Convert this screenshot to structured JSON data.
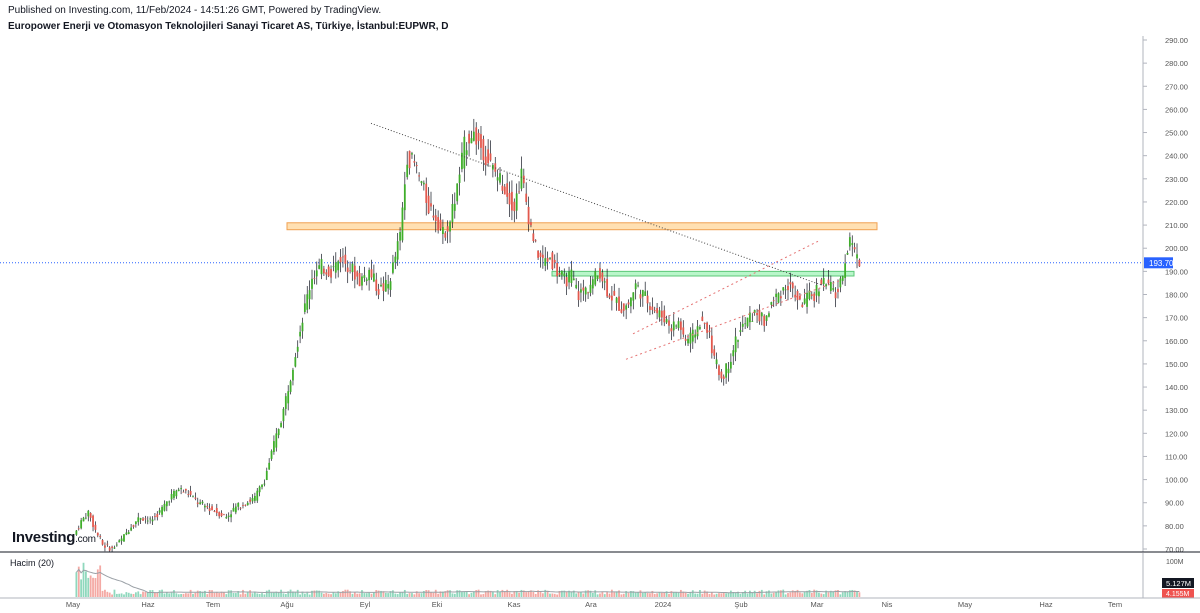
{
  "header": {
    "published": "Published on Investing.com, 11/Feb/2024 - 14:51:26 GMT, Powered by TradingView.",
    "symbol": "Europower Enerji ve Otomasyon Teknolojileri Sanayi Ticaret AS, Türkiye, İstanbul:EUPWR, D"
  },
  "logo": {
    "text": "Investing",
    "suffix": ".com"
  },
  "volume_panel": {
    "label": "Hacim (20)",
    "axis_max_label": "100M",
    "last_label": "5.127M",
    "ma_label": "4.155M"
  },
  "colors": {
    "up": "#26a69a",
    "down": "#ef5350",
    "up_candle": "#3fae2a",
    "down_candle": "#e2584d",
    "price_line": "#2962ff",
    "zone_resistance": "#ffe0b2",
    "zone_support": "#b9f6ca"
  },
  "chart_data": {
    "type": "candlestick",
    "title": "EUPWR, D",
    "y_axis": {
      "range": [
        70,
        290
      ],
      "ticks": [
        "70.00",
        "80.00",
        "90.00",
        "100.00",
        "110.00",
        "120.00",
        "130.00",
        "140.00",
        "150.00",
        "160.00",
        "170.00",
        "180.00",
        "190.00",
        "200.00",
        "210.00",
        "220.00",
        "230.00",
        "240.00",
        "250.00",
        "260.00",
        "270.00",
        "280.00",
        "290.00"
      ],
      "position": "right"
    },
    "x_axis": {
      "labels": [
        "May",
        "Haz",
        "Tem",
        "Ağu",
        "Eyl",
        "Eki",
        "Kas",
        "Ara",
        "2024",
        "Şub",
        "Mar",
        "Nis",
        "May",
        "Haz",
        "Tem"
      ]
    },
    "last_price": "193.70",
    "price_path": [
      [
        0,
        76
      ],
      [
        3,
        82
      ],
      [
        6,
        86
      ],
      [
        9,
        78
      ],
      [
        12,
        72
      ],
      [
        16,
        70
      ],
      [
        20,
        74
      ],
      [
        24,
        80
      ],
      [
        28,
        84
      ],
      [
        32,
        82
      ],
      [
        36,
        86
      ],
      [
        40,
        92
      ],
      [
        44,
        96
      ],
      [
        48,
        94
      ],
      [
        52,
        90
      ],
      [
        56,
        88
      ],
      [
        60,
        86
      ],
      [
        64,
        84
      ],
      [
        68,
        88
      ],
      [
        72,
        90
      ],
      [
        76,
        92
      ],
      [
        80,
        100
      ],
      [
        84,
        115
      ],
      [
        88,
        130
      ],
      [
        92,
        150
      ],
      [
        96,
        170
      ],
      [
        100,
        188
      ],
      [
        104,
        192
      ],
      [
        108,
        190
      ],
      [
        112,
        196
      ],
      [
        116,
        192
      ],
      [
        120,
        186
      ],
      [
        124,
        190
      ],
      [
        128,
        182
      ],
      [
        132,
        184
      ],
      [
        134,
        192
      ],
      [
        137,
        205
      ],
      [
        140,
        240
      ],
      [
        143,
        236
      ],
      [
        146,
        228
      ],
      [
        149,
        218
      ],
      [
        152,
        214
      ],
      [
        155,
        206
      ],
      [
        158,
        212
      ],
      [
        161,
        226
      ],
      [
        164,
        244
      ],
      [
        167,
        250
      ],
      [
        170,
        246
      ],
      [
        173,
        240
      ],
      [
        176,
        234
      ],
      [
        179,
        230
      ],
      [
        182,
        224
      ],
      [
        185,
        218
      ],
      [
        188,
        232
      ],
      [
        191,
        214
      ],
      [
        194,
        200
      ],
      [
        197,
        194
      ],
      [
        200,
        196
      ],
      [
        203,
        190
      ],
      [
        206,
        186
      ],
      [
        209,
        188
      ],
      [
        212,
        180
      ],
      [
        215,
        182
      ],
      [
        218,
        186
      ],
      [
        221,
        190
      ],
      [
        224,
        182
      ],
      [
        227,
        178
      ],
      [
        230,
        174
      ],
      [
        233,
        176
      ],
      [
        236,
        184
      ],
      [
        239,
        180
      ],
      [
        242,
        176
      ],
      [
        245,
        172
      ],
      [
        248,
        170
      ],
      [
        251,
        166
      ],
      [
        254,
        168
      ],
      [
        257,
        160
      ],
      [
        260,
        162
      ],
      [
        263,
        168
      ],
      [
        266,
        166
      ],
      [
        269,
        152
      ],
      [
        272,
        144
      ],
      [
        275,
        150
      ],
      [
        278,
        160
      ],
      [
        281,
        166
      ],
      [
        284,
        170
      ],
      [
        287,
        172
      ],
      [
        290,
        168
      ],
      [
        293,
        176
      ],
      [
        296,
        180
      ],
      [
        299,
        184
      ],
      [
        302,
        182
      ],
      [
        305,
        176
      ],
      [
        308,
        178
      ],
      [
        311,
        180
      ],
      [
        314,
        186
      ],
      [
        317,
        184
      ],
      [
        320,
        180
      ],
      [
        322,
        184
      ],
      [
        324,
        196
      ],
      [
        326,
        204
      ],
      [
        328,
        198
      ],
      [
        330,
        194
      ]
    ],
    "annotations": [
      {
        "type": "zone",
        "name": "resistance",
        "y": [
          208,
          211
        ]
      },
      {
        "type": "zone",
        "name": "support",
        "y": [
          188,
          190
        ]
      },
      {
        "type": "trendline",
        "style": "dotted",
        "from": [
          167,
          254
        ],
        "to": [
          345,
          184
        ]
      },
      {
        "type": "channel",
        "style": "dashed"
      }
    ]
  }
}
